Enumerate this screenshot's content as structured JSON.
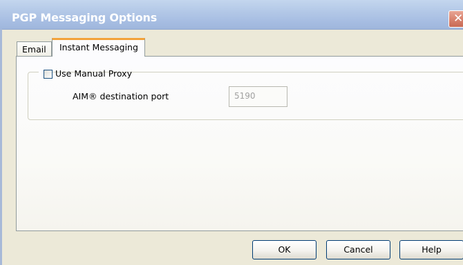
{
  "window": {
    "title": "PGP Messaging Options",
    "close_icon": "close-icon",
    "close_glyph": "✕"
  },
  "tabs": [
    {
      "label": "Email",
      "selected": false
    },
    {
      "label": "Instant Messaging",
      "selected": true
    }
  ],
  "proxy_group": {
    "checkbox_label": "Use Manual Proxy",
    "checked": false,
    "port_label": "AIM® destination port",
    "port_value": "5190",
    "port_enabled": false
  },
  "buttons": {
    "ok": "OK",
    "cancel": "Cancel",
    "help": "Help"
  },
  "colors": {
    "titlebar": "#b3c8e7",
    "selected_tab_accent": "#f3a23a",
    "button_border": "#003c74",
    "close_button": "#d98470"
  }
}
